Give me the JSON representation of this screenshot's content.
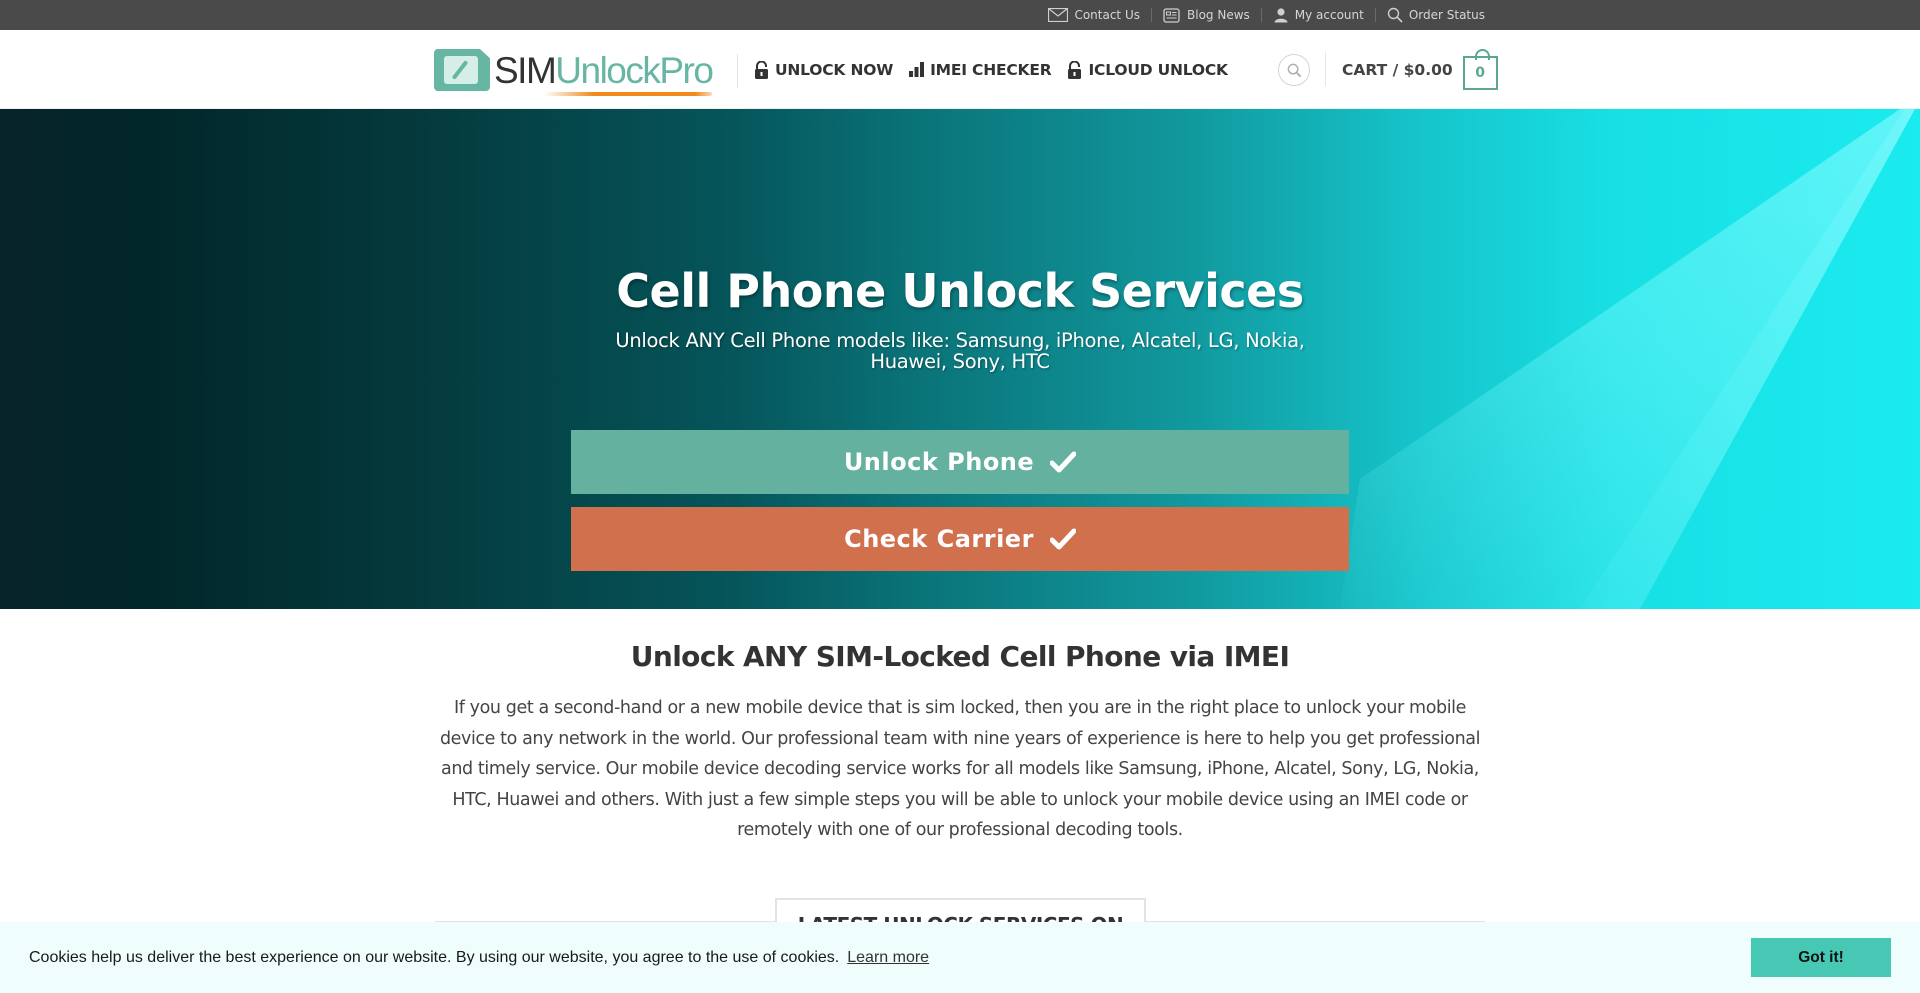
{
  "topbar": {
    "items": [
      {
        "label": "Contact Us",
        "icon": "mail-icon"
      },
      {
        "label": "Blog News",
        "icon": "newspaper-icon"
      },
      {
        "label": "My account",
        "icon": "user-icon"
      },
      {
        "label": "Order Status",
        "icon": "search-icon"
      }
    ]
  },
  "header": {
    "logo": {
      "part1": "SIM",
      "part2": "UnlockPro"
    },
    "nav": [
      {
        "label": "UNLOCK NOW",
        "icon": "unlock-icon"
      },
      {
        "label": "IMEI CHECKER",
        "icon": "bar-chart-icon"
      },
      {
        "label": "ICLOUD UNLOCK",
        "icon": "unlock-icon"
      }
    ],
    "cart": {
      "label": "CART / $0.00",
      "count": "0"
    }
  },
  "hero": {
    "title": "Cell Phone Unlock Services",
    "subtitle": "Unlock ANY Cell Phone models like: Samsung, iPhone, Alcatel, LG, Nokia, Huawei, Sony, HTC",
    "buttons": [
      {
        "label": "Unlock Phone",
        "icon": "check-icon",
        "color": "#65b1a0"
      },
      {
        "label": "Check Carrier",
        "icon": "check-icon",
        "color": "#d0704d"
      }
    ]
  },
  "content": {
    "title": "Unlock ANY SIM-Locked Cell Phone via IMEI",
    "paragraph": "If you get a second-hand or a new mobile device that is sim locked, then you are in the right place to unlock your mobile device to any network in the world. Our professional team with nine years of experience is here to help you get professional and timely service. Our mobile device decoding service works for all models like Samsung, iPhone, Alcatel, Sony, LG, Nokia, HTC, Huawei and others. With just a few simple steps you will be able to unlock your mobile device using an IMEI code or remotely with one of our professional decoding tools.",
    "latest_heading": "LATEST UNLOCK SERVICES ON SALE"
  },
  "cookie": {
    "text": "Cookies help us deliver the best experience on our website. By using our website, you agree to the use of cookies.",
    "link": "Learn more",
    "button": "Got it!"
  },
  "colors": {
    "accent": "#67b6a4",
    "orange": "#d0704d",
    "topbar": "#4a4a4a",
    "cookie_button": "#46c8b5"
  }
}
